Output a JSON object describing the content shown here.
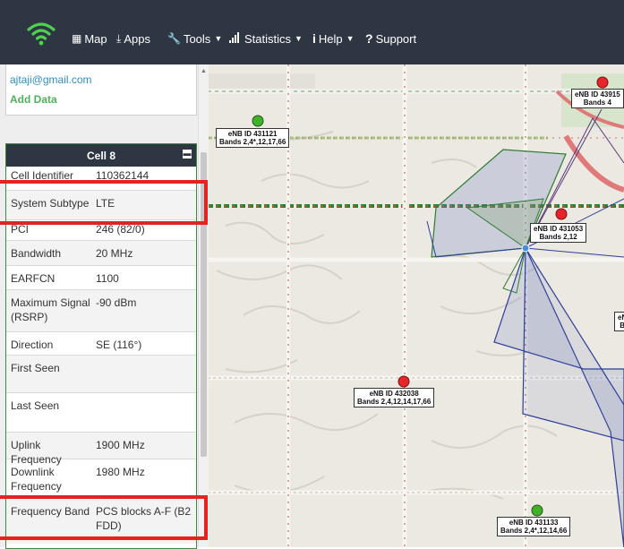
{
  "nav": {
    "items": [
      {
        "label": "Map",
        "icon": "map-icon",
        "dropdown": false
      },
      {
        "label": "Apps",
        "icon": "download-icon",
        "dropdown": false
      },
      {
        "label": "Tools",
        "icon": "wrench-icon",
        "dropdown": true
      },
      {
        "label": "Statistics",
        "icon": "signal-bars-icon",
        "dropdown": true
      },
      {
        "label": "Help",
        "icon": "info-icon",
        "dropdown": true
      },
      {
        "label": "Support",
        "icon": "question-icon",
        "dropdown": false
      }
    ]
  },
  "user": {
    "email": "ajtaji@gmail.com",
    "add_data": "Add Data"
  },
  "cell": {
    "title": "Cell 8",
    "rows": [
      {
        "label": "Cell Identifier",
        "value": "110362144"
      },
      {
        "label": "System Subtype",
        "value": "LTE"
      },
      {
        "label": "PCI",
        "value": "246 (82/0)"
      },
      {
        "label": "Bandwidth",
        "value": "20 MHz"
      },
      {
        "label": "EARFCN",
        "value": "1100"
      },
      {
        "label": "Maximum Signal (RSRP)",
        "value": "-90 dBm"
      },
      {
        "label": "Direction",
        "value": "SE (116°)"
      },
      {
        "label": "First Seen",
        "value": ""
      },
      {
        "label": "Last Seen",
        "value": ""
      },
      {
        "label": "Uplink Frequency",
        "value": "1900 MHz"
      },
      {
        "label": "Downlink Frequency",
        "value": "1980 MHz"
      },
      {
        "label": "Frequency Band",
        "value": "PCS blocks A-F (B2 FDD)"
      }
    ]
  },
  "map": {
    "markers": [
      {
        "line1": "eNB ID 431121",
        "line2": "Bands 2,4*,12,17,66",
        "color": "#43b02a"
      },
      {
        "line1": "eNB ID 43915",
        "line2": "Bands 4",
        "color": "#e8242b"
      },
      {
        "line1": "eNB ID 431053",
        "line2": "Bands 2,12",
        "color": "#e8242b"
      },
      {
        "line1": "eNB ID 432038",
        "line2": "Bands 2,4,12,14,17,66",
        "color": "#e8242b"
      },
      {
        "line1": "eNB ID 431133",
        "line2": "Bands 2,4*,12,14,66",
        "color": "#43b02a"
      },
      {
        "line1": "eN",
        "line2": "B",
        "color": "#e8242b"
      }
    ]
  },
  "colors": {
    "navbar": "#2e3643",
    "highlight": "#e32222",
    "accent": "#4fb25a",
    "link": "#2f8fc0"
  }
}
